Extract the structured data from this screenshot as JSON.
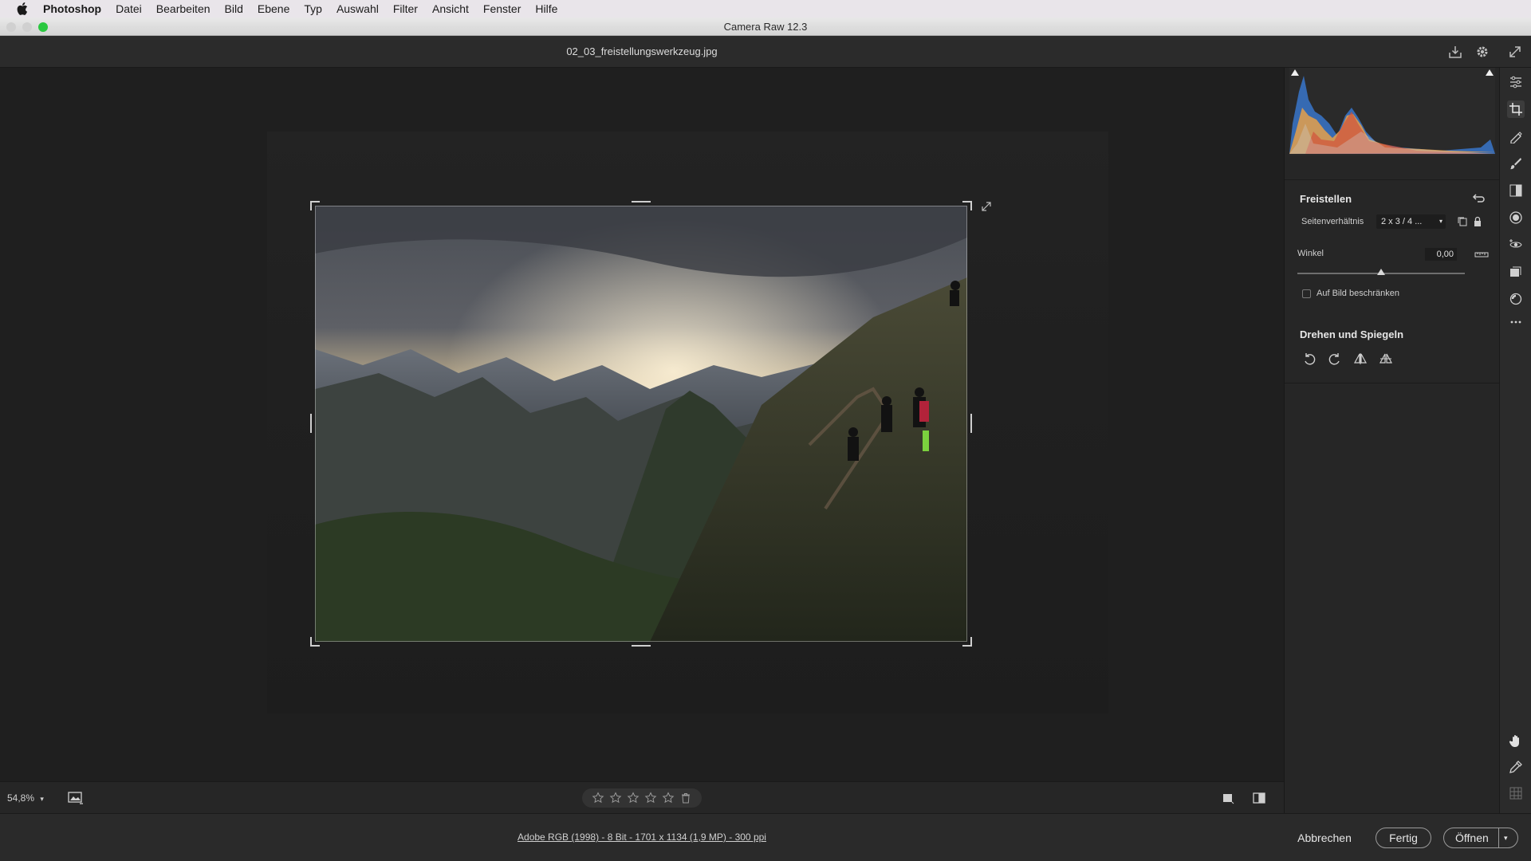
{
  "menubar": {
    "app": "Photoshop",
    "items": [
      "Datei",
      "Bearbeiten",
      "Bild",
      "Ebene",
      "Typ",
      "Auswahl",
      "Filter",
      "Ansicht",
      "Fenster",
      "Hilfe"
    ]
  },
  "window": {
    "title": "Camera Raw 12.3"
  },
  "header": {
    "filename": "02_03_freistellungswerkzeug.jpg"
  },
  "canvas": {
    "zoom": "54,8%",
    "rating_icons": [
      "star-icon",
      "star-icon",
      "star-icon",
      "star-icon",
      "star-icon",
      "trash-icon"
    ]
  },
  "footer": {
    "info": "Adobe RGB (1998) - 8 Bit - 1701 x 1134 (1,9 MP) - 300 ppi",
    "cancel": "Abbrechen",
    "done": "Fertig",
    "open": "Öffnen"
  },
  "panel": {
    "crop": {
      "title": "Freistellen",
      "aspect_label": "Seitenverhältnis",
      "aspect_value": "2 x 3  / 4 ...",
      "angle_label": "Winkel",
      "angle_value": "0,00",
      "angle_slider_level": 0.5,
      "constrain_label": "Auf Bild beschränken",
      "constrain_checked": false
    },
    "rotate": {
      "title": "Drehen und Spiegeln",
      "icons": [
        "rotate-ccw-icon",
        "rotate-cw-icon",
        "flip-horizontal-icon",
        "flip-vertical-icon"
      ]
    }
  },
  "colors": {
    "accent": "#2f6fd6",
    "histogram_blue": "#3a7bd5",
    "histogram_orange": "#e5a04a",
    "histogram_red": "#d2533b"
  }
}
